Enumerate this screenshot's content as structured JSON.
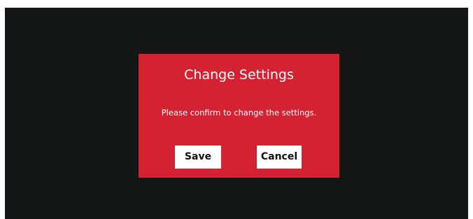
{
  "dialog": {
    "title": "Change Settings",
    "message": "Please confirm to change the settings.",
    "save_label": "Save",
    "cancel_label": "Cancel"
  },
  "colors": {
    "backdrop": "#141716",
    "dialog_background": "#d42233",
    "button_background": "#ffffff",
    "text_on_dialog": "#ffffff",
    "button_text": "#111111"
  }
}
